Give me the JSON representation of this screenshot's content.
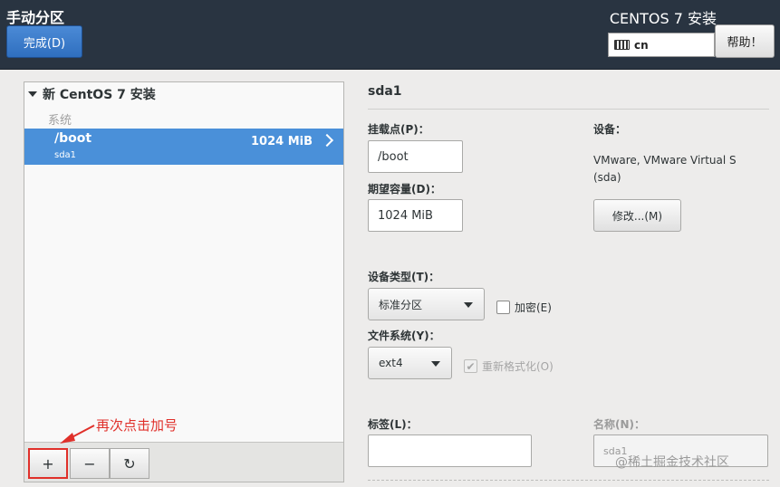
{
  "header": {
    "title": "手动分区",
    "done_label": "完成(D)",
    "product": "CENTOS 7 安装",
    "keyboard_layout": "cn",
    "help_label": "帮助！"
  },
  "left_panel": {
    "group_title": "新 CentOS 7 安装",
    "section": "系统",
    "partition": {
      "mount_point": "/boot",
      "device": "sda1",
      "size": "1024 MiB"
    },
    "toolbar": {
      "add": "+",
      "remove": "−",
      "reset": "↻"
    }
  },
  "annotation": "再次点击加号",
  "right_panel": {
    "title": "sda1",
    "mount_label": "挂载点(P)：",
    "mount_value": "/boot",
    "capacity_label": "期望容量(D)：",
    "capacity_value": "1024 MiB",
    "device_label": "设备：",
    "device_desc": "VMware, VMware Virtual S (sda)",
    "modify_label": "修改...(M)",
    "device_type_label": "设备类型(T)：",
    "device_type_value": "标准分区",
    "encrypt_label": "加密(E)",
    "filesystem_label": "文件系统(Y)：",
    "filesystem_value": "ext4",
    "reformat_label": "重新格式化(O)",
    "tag_label": "标签(L)：",
    "tag_value": "",
    "name_label": "名称(N)：",
    "name_value": "sda1"
  },
  "watermark": "@稀土掘金技术社区",
  "colors": {
    "header_bg": "#293441",
    "selection": "#4a90d9",
    "annotation": "#e0302a"
  }
}
